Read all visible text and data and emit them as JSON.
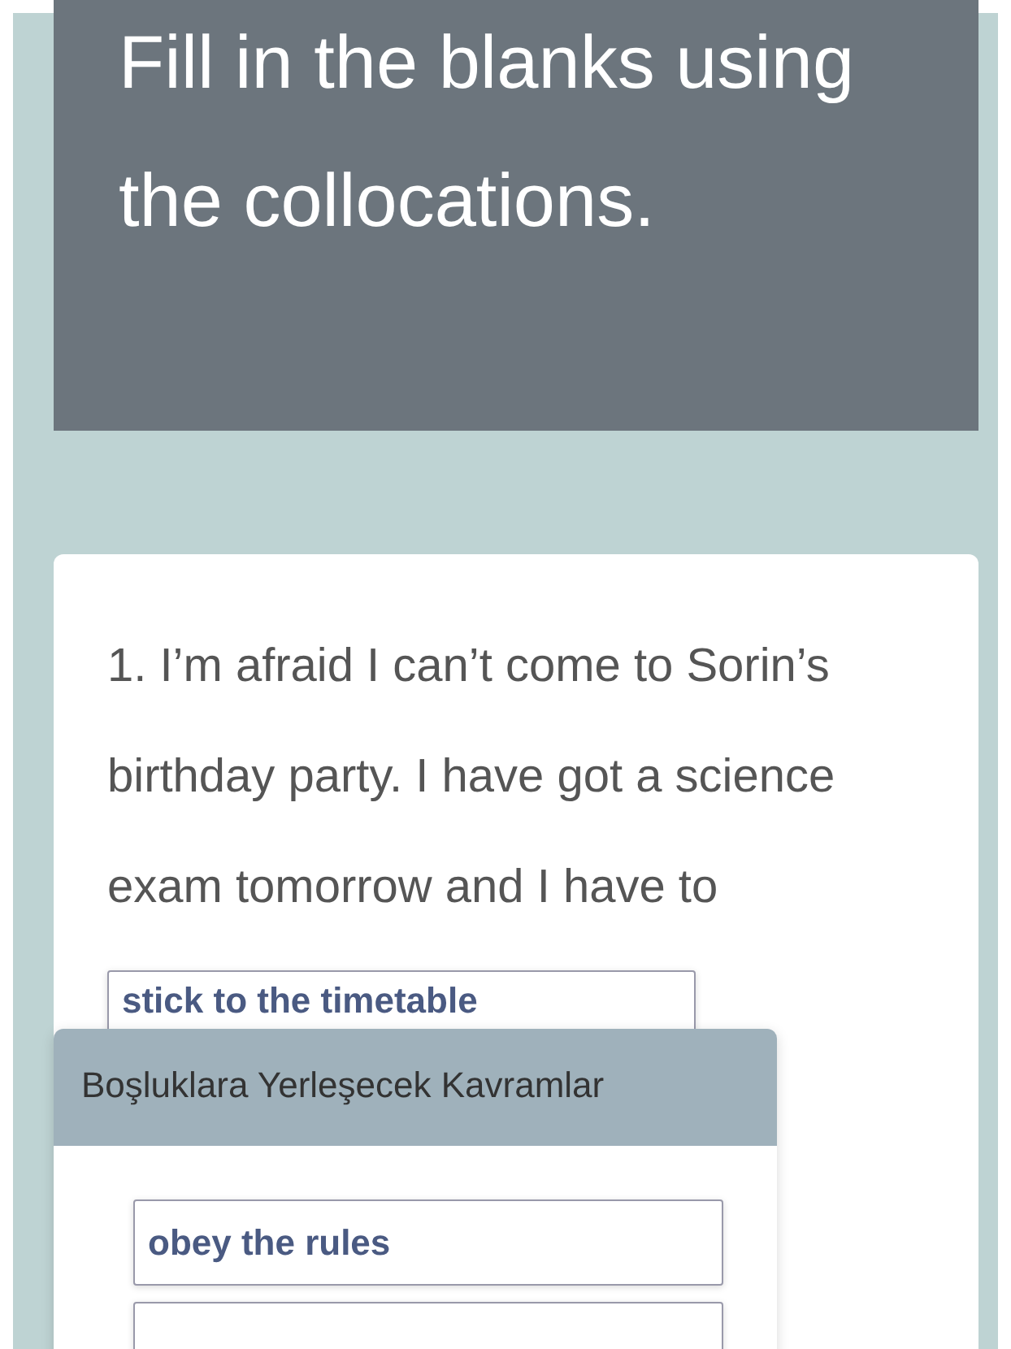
{
  "header": {
    "title": "Fill in the blanks using the collocations."
  },
  "question": {
    "text": "1. I’m afraid I can’t come to Sorin’s birthday party. I have got a science exam tomorrow and I have to",
    "answer": "stick to the timetable"
  },
  "word_bank": {
    "title": "Boşluklara Yerleşecek Kavramlar",
    "options": [
      {
        "kind": "field",
        "value": "obey the rules"
      },
      {
        "kind": "cut-off"
      }
    ]
  }
}
